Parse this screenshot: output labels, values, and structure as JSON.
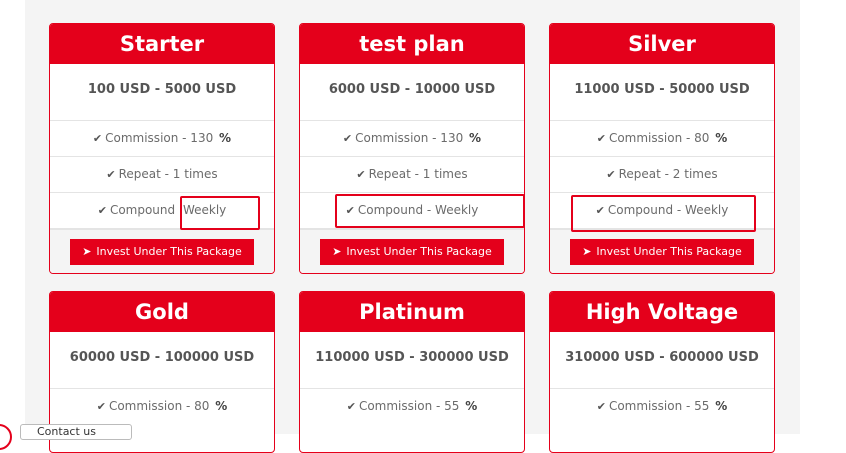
{
  "plans": [
    {
      "name": "Starter",
      "range": "100 USD - 5000 USD",
      "commission": "Commission - 130",
      "repeat": "Repeat - 1 times",
      "compound_label": "Compound",
      "compound_value": "Weekly",
      "button": "Invest Under This Package"
    },
    {
      "name": "test plan",
      "range": "6000 USD - 10000 USD",
      "commission": "Commission - 130",
      "repeat": "Repeat - 1 times",
      "compound_label": "Compound -",
      "compound_value": "Weekly",
      "button": "Invest Under This Package"
    },
    {
      "name": "Silver",
      "range": "11000 USD - 50000 USD",
      "commission": "Commission - 80",
      "repeat": "Repeat - 2 times",
      "compound_label": "Compound -",
      "compound_value": "Weekly",
      "button": "Invest Under This Package"
    },
    {
      "name": "Gold",
      "range": "60000 USD - 100000 USD",
      "commission": "Commission - 80"
    },
    {
      "name": "Platinum",
      "range": "110000 USD - 300000 USD",
      "commission": "Commission - 55"
    },
    {
      "name": "High Voltage",
      "range": "310000 USD - 600000 USD",
      "commission": "Commission - 55"
    }
  ],
  "percent_sign": "%",
  "contact_label": "Contact us",
  "colors": {
    "accent": "#e4001b",
    "panel_bg": "#f4f4f4",
    "text": "#6b6b6b"
  },
  "icons": {
    "check": "check-icon",
    "invest": "paper-plane-icon"
  }
}
